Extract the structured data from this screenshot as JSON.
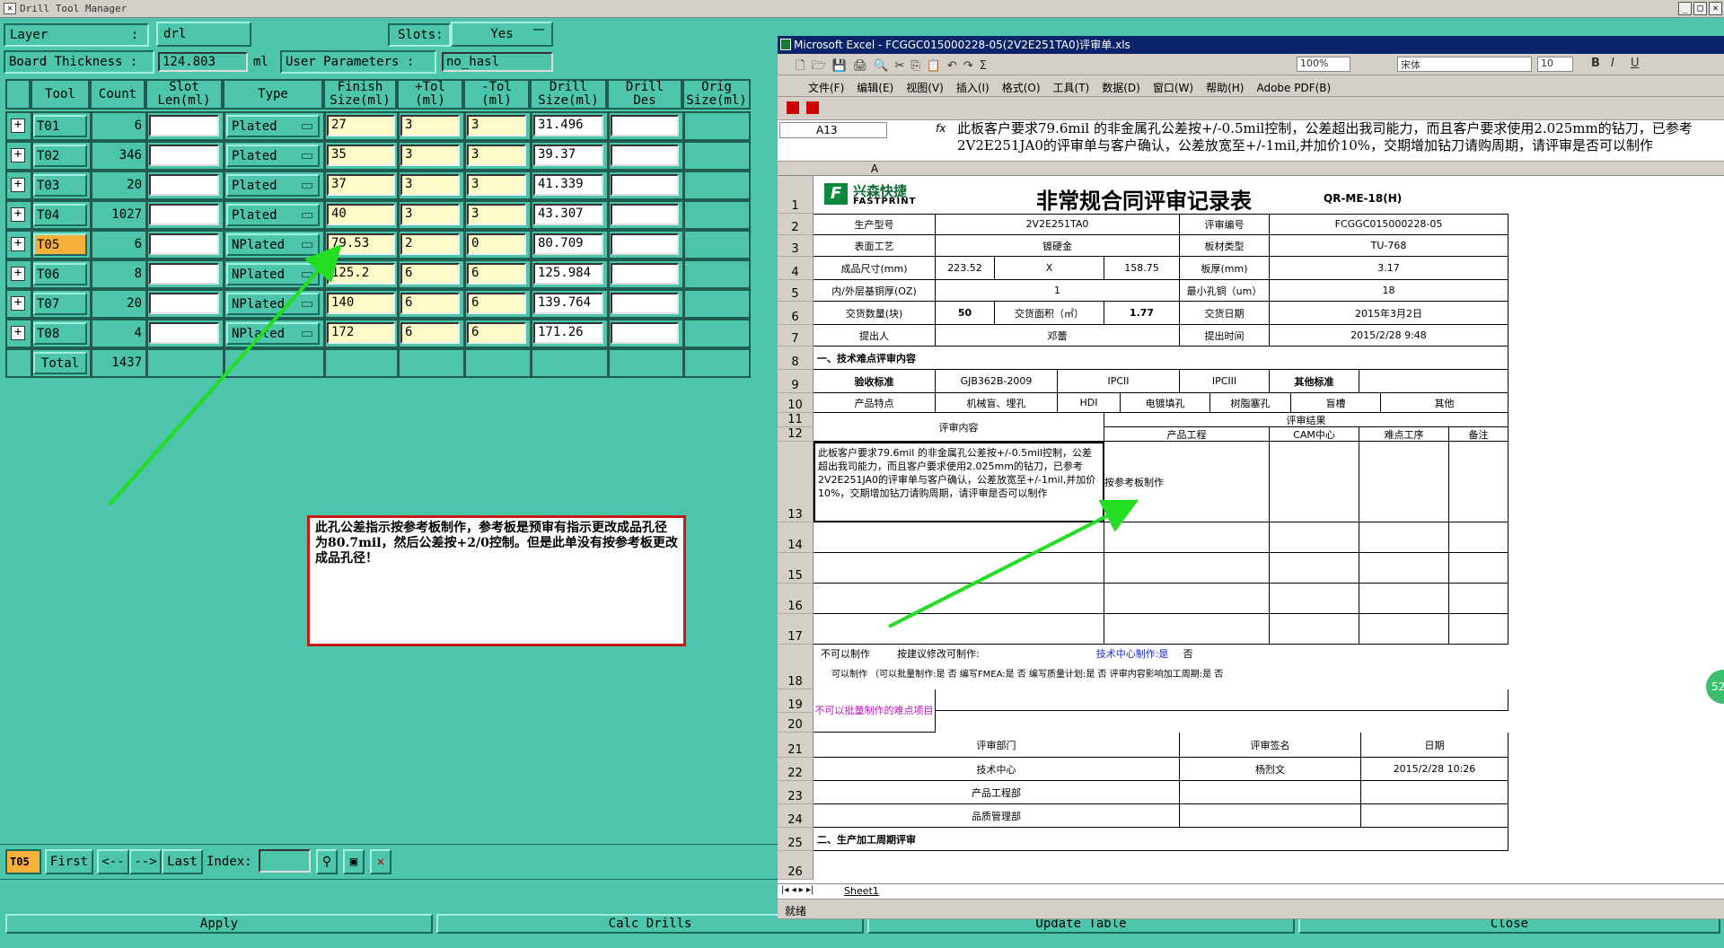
{
  "window_title": "Drill Tool Manager",
  "top": {
    "layer_label": "Layer",
    "layer_sep": ":",
    "layer_value": "drl",
    "slots_label": "Slots:",
    "slots_value": "Yes",
    "board_thickness_label": "Board Thickness :",
    "board_thickness_value": "124.803",
    "board_thickness_unit": "ml",
    "user_params_label": "User Parameters :",
    "user_params_value": "no_hasl"
  },
  "columns": [
    "Tool",
    "Count",
    "Slot\nLen(ml)",
    "Type",
    "Finish\nSize(ml)",
    "+Tol\n(ml)",
    "-Tol\n(ml)",
    "Drill\nSize(ml)",
    "Drill\nDes",
    "Orig\nSize(ml)"
  ],
  "rows": [
    {
      "tool": "T01",
      "count": "6",
      "type": "Plated",
      "finish": "27",
      "ptol": "3",
      "ntol": "3",
      "drill": "31.496"
    },
    {
      "tool": "T02",
      "count": "346",
      "type": "Plated",
      "finish": "35",
      "ptol": "3",
      "ntol": "3",
      "drill": "39.37"
    },
    {
      "tool": "T03",
      "count": "20",
      "type": "Plated",
      "finish": "37",
      "ptol": "3",
      "ntol": "3",
      "drill": "41.339"
    },
    {
      "tool": "T04",
      "count": "1027",
      "type": "Plated",
      "finish": "40",
      "ptol": "3",
      "ntol": "3",
      "drill": "43.307"
    },
    {
      "tool": "T05",
      "count": "6",
      "type": "NPlated",
      "finish": "79.53",
      "ptol": "2",
      "ntol": "0",
      "drill": "80.709"
    },
    {
      "tool": "T06",
      "count": "8",
      "type": "NPlated",
      "finish": "125.2",
      "ptol": "6",
      "ntol": "6",
      "drill": "125.984"
    },
    {
      "tool": "T07",
      "count": "20",
      "type": "NPlated",
      "finish": "140",
      "ptol": "6",
      "ntol": "6",
      "drill": "139.764"
    },
    {
      "tool": "T08",
      "count": "4",
      "type": "NPlated",
      "finish": "172",
      "ptol": "6",
      "ntol": "6",
      "drill": "171.26"
    }
  ],
  "total_label": "Total",
  "total_value": "1437",
  "note_text": "此孔公差指示按参考板制作，参考板是预审有指示更改成品孔径为80.7mil，然后公差按+2/0控制。但是此单没有按参考板更改成品孔径！",
  "nav": {
    "current": "T05",
    "first": "First",
    "prev": "<--",
    "next": "-->",
    "last": "Last",
    "index_label": "Index:"
  },
  "bottom_buttons": {
    "apply": "Apply",
    "calc": "Calc Drills",
    "update": "Update Table",
    "close": "Close"
  },
  "excel": {
    "title": "Microsoft Excel - FCGGC015000228-05(2V2E251TA0)评审单.xls",
    "menu": [
      "文件(F)",
      "编辑(E)",
      "视图(V)",
      "插入(I)",
      "格式(O)",
      "工具(T)",
      "数据(D)",
      "窗口(W)",
      "帮助(H)",
      "Adobe PDF(B)"
    ],
    "zoom": "100%",
    "font": "宋体",
    "font_size": "10",
    "name_box": "A13",
    "formula": "此板客户要求79.6mil 的非金属孔公差按+/-0.5mil控制，公差超出我司能力，而且客户要求使用2.025mm的钻刀，已参考2V2E251JA0的评审单与客户确认，公差放宽至+/-1mil,并加价10%，交期增加钻刀请购周期，请评审是否可以制作",
    "col_a": "A",
    "logo_cn": "兴森快捷",
    "logo_en": "FASTPRINT",
    "sheet_title": "非常规合同评审记录表",
    "form_code": "QR-ME-18(H)",
    "r2": [
      "生产型号",
      "2V2E251TA0",
      "评审编号",
      "FCGGC015000228-05"
    ],
    "r3": [
      "表面工艺",
      "镀硬金",
      "板材类型",
      "TU-768"
    ],
    "r4": [
      "成品尺寸(mm)",
      "223.52",
      "X",
      "158.75",
      "板厚(mm)",
      "3.17"
    ],
    "r5": [
      "内/外层基铜厚(OZ)",
      "1",
      "最小孔铜（um）",
      "18"
    ],
    "r6": [
      "交货数量(块)",
      "50",
      "交货面积（㎡）",
      "1.77",
      "交货日期",
      "2015年3月2日"
    ],
    "r7": [
      "提出人",
      "邓蕾",
      "提出时间",
      "2015/2/28 9:48"
    ],
    "r8": "一、技术难点评审内容",
    "r9": [
      "验收标准",
      "GJB362B-2009",
      "IPCII",
      "IPCIII",
      "其他标准"
    ],
    "r10": [
      "产品特点",
      "机械盲、埋孔",
      "HDI",
      "电镀填孔",
      "树脂塞孔",
      "盲槽",
      "其他"
    ],
    "r11": [
      "评审内容",
      "评审结果"
    ],
    "r12": [
      "产品工程",
      "CAM中心",
      "难点工序",
      "备注"
    ],
    "r13_content": "此板客户要求79.6mil 的非金属孔公差按+/-0.5mil控制，公差超出我司能力，而且客户要求使用2.025mm的钻刀，已参考2V2E251JA0的评审单与客户确认，公差放宽至+/-1mil,并加价10%，交期增加钻刀请购周期，请评审是否可以制作",
    "r13_result": "按参考板制作",
    "r17a": [
      "不可以制作",
      "按建议修改可制作:",
      "技术中心制作:是",
      "否"
    ],
    "r18": "可以制作  （可以批量制作:是  否   编写FMEA:是  否   编写质量计划:是  否   评审内容影响加工周期:是  否",
    "r19": "不可以批量制作的难点项目",
    "r21": [
      "评审部门",
      "评审签名",
      "日期"
    ],
    "r22": [
      "技术中心",
      "杨烈文",
      "2015/2/28 10:26"
    ],
    "r23": "产品工程部",
    "r24": "品质管理部",
    "r25": "二、生产加工周期评审",
    "sheet_tab": "Sheet1",
    "status": "就绪",
    "row_numbers": [
      "1",
      "2",
      "3",
      "4",
      "5",
      "6",
      "7",
      "8",
      "9",
      "10",
      "11",
      "12",
      "13",
      "14",
      "15",
      "16",
      "17",
      "18",
      "19",
      "20",
      "21",
      "22",
      "23",
      "24",
      "25",
      "26"
    ],
    "badge": "52"
  },
  "colors": {
    "bg": "#4dc5ab",
    "field_yellow": "#fffbc8",
    "highlight": "#f7b03a",
    "arrow": "#22dd22",
    "note_border": "#d01010"
  }
}
